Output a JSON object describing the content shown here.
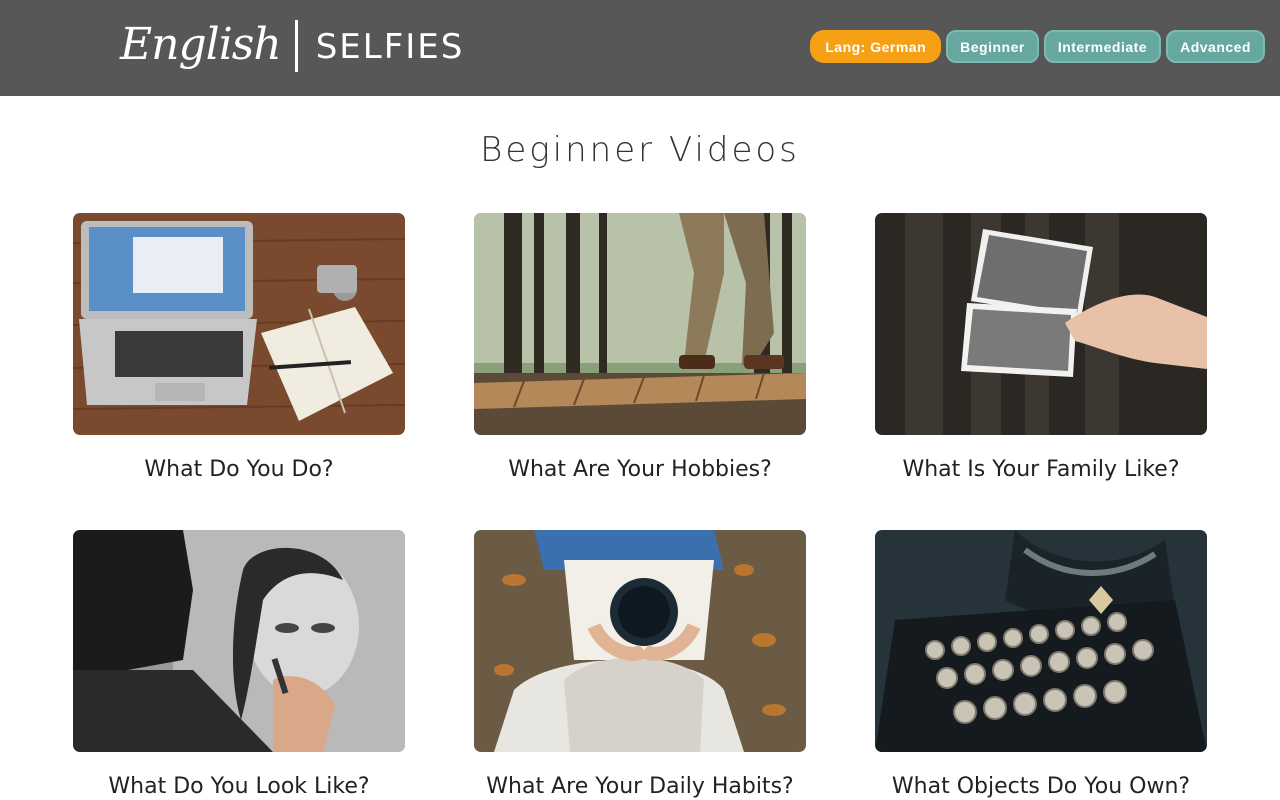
{
  "header": {
    "logo": {
      "part1": "English",
      "part2": "SELFIES"
    },
    "nav": [
      {
        "id": "lang",
        "label": "Lang: German"
      },
      {
        "id": "beginner",
        "label": "Beginner"
      },
      {
        "id": "intermediate",
        "label": "Intermediate"
      },
      {
        "id": "advanced",
        "label": "Advanced"
      }
    ]
  },
  "main": {
    "title": "Beginner Videos",
    "videos": [
      {
        "title": "What Do You Do?",
        "thumb_icon": "laptop-notebook-photo"
      },
      {
        "title": "What Are Your Hobbies?",
        "thumb_icon": "forest-walk-photo"
      },
      {
        "title": "What Is Your Family Like?",
        "thumb_icon": "old-family-photos"
      },
      {
        "title": "What Do You Look Like?",
        "thumb_icon": "portrait-drawing-photo"
      },
      {
        "title": "What Are Your Daily Habits?",
        "thumb_icon": "coffee-cup-photo"
      },
      {
        "title": "What Objects Do You Own?",
        "thumb_icon": "typewriter-photo"
      }
    ]
  },
  "colors": {
    "header_bg": "#575757",
    "lang_pill": "#f6a015",
    "level_pill": "#66a8a0"
  }
}
